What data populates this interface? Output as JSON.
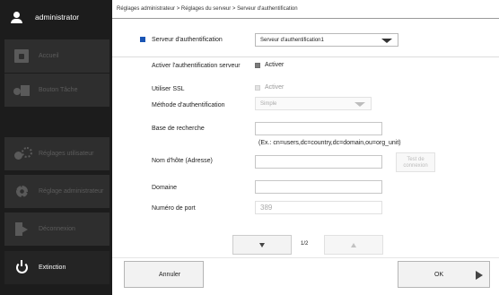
{
  "user": {
    "name": "administrator"
  },
  "sidebar": {
    "items": [
      {
        "label": "Accueil",
        "icon": "home-icon"
      },
      {
        "label": "Bouton Tâche",
        "icon": "task-button-icon"
      },
      {
        "label": "Réglages utilisateur",
        "icon": "user-settings-icon"
      },
      {
        "label": "Réglage administrateur",
        "icon": "gear-icon"
      },
      {
        "label": "Déconnexion",
        "icon": "logout-icon"
      },
      {
        "label": "Extinction",
        "icon": "power-icon"
      }
    ]
  },
  "breadcrumb": "Réglages administrateur > Réglages du serveur > Serveur d'authentification",
  "form": {
    "server_label": "Serveur d'authentification",
    "server_value": "Serveur d'authentification1",
    "enable_auth_label": "Activer l'authentification serveur",
    "enable_auth_option": "Activer",
    "ssl_label": "Utiliser SSL",
    "ssl_option": "Activer",
    "method_label": "Méthode d'authentification",
    "method_value": "Simple",
    "search_base_label": "Base de recherche",
    "search_base_value": "",
    "search_base_hint": "(Ex.: cn=users,dc=country,dc=domain,ou=org_unit)",
    "hostname_label": "Nom d'hôte (Adresse)",
    "hostname_value": "",
    "test_conn_line1": "Test de",
    "test_conn_line2": "connexion",
    "domain_label": "Domaine",
    "domain_value": "",
    "port_label": "Numéro de port",
    "port_value": "389"
  },
  "pagination": {
    "page": "1/2"
  },
  "footer": {
    "cancel_label": "Annuler",
    "ok_label": "OK"
  },
  "colors": {
    "accent": "#1a55b4",
    "sidebar_bg": "#1c1c1c",
    "nav_button_bg": "#2e2e2e"
  }
}
